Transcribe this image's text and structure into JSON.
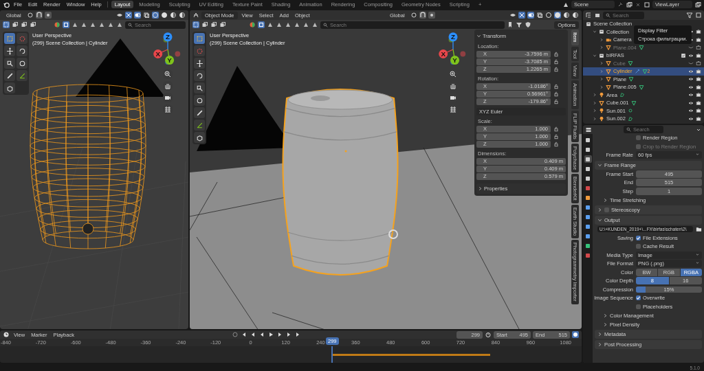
{
  "topbar": {
    "menus": [
      "File",
      "Edit",
      "Render",
      "Window",
      "Help"
    ],
    "workspaces": [
      {
        "label": "Layout",
        "selected": true
      },
      {
        "label": "Modeling",
        "selected": false
      },
      {
        "label": "Sculpting",
        "selected": false
      },
      {
        "label": "UV Editing",
        "selected": false
      },
      {
        "label": "Texture Paint",
        "selected": false
      },
      {
        "label": "Shading",
        "selected": false
      },
      {
        "label": "Animation",
        "selected": false
      },
      {
        "label": "Rendering",
        "selected": false
      },
      {
        "label": "Compositing",
        "selected": false
      },
      {
        "label": "Geometry Nodes",
        "selected": false
      },
      {
        "label": "Scripting",
        "selected": false
      }
    ],
    "add_workspace": "+",
    "scene": "Scene",
    "view_layer": "ViewLayer"
  },
  "viewports": [
    {
      "kind": "wireframe",
      "orientation": "Global",
      "search_placeholder": "Search",
      "view_name": "User Perspective",
      "info": "(299) Scene Collection | Cylinder",
      "tools": [
        {
          "kind": "select",
          "selected": true
        },
        {
          "kind": "cursor",
          "selected": false
        },
        {
          "kind": "move",
          "selected": false
        },
        {
          "kind": "rotate",
          "selected": false
        },
        {
          "kind": "scale",
          "selected": false
        },
        {
          "kind": "transform",
          "selected": false
        },
        {
          "kind": "annotate",
          "selected": false
        },
        {
          "kind": "measure",
          "selected": false
        },
        {
          "kind": "add-cube",
          "selected": false
        }
      ],
      "gizmo_axes": [
        {
          "label": "X",
          "color": "#e8464b"
        },
        {
          "label": "Y",
          "color": "#7fc31c"
        },
        {
          "label": "Z",
          "color": "#2c8fff"
        }
      ]
    },
    {
      "kind": "solid",
      "mode": "Object Mode",
      "menus": [
        "View",
        "Select",
        "Add",
        "Object"
      ],
      "orientation": "Global",
      "search_placeholder": "Search",
      "options": "Options",
      "view_name": "User Perspective",
      "info": "(299) Scene Collection | Cylinder",
      "tools": [
        {
          "kind": "select",
          "selected": true
        },
        {
          "kind": "cursor",
          "selected": false
        },
        {
          "kind": "move",
          "selected": false
        },
        {
          "kind": "rotate",
          "selected": false
        },
        {
          "kind": "scale",
          "selected": false
        },
        {
          "kind": "transform",
          "selected": false
        },
        {
          "kind": "annotate",
          "selected": false
        },
        {
          "kind": "measure",
          "selected": false
        },
        {
          "kind": "add-cube",
          "selected": false
        }
      ],
      "gizmo_axes": [
        {
          "label": "X",
          "color": "#e8464b"
        },
        {
          "label": "Y",
          "color": "#7fc31c"
        },
        {
          "label": "Z",
          "color": "#2c8fff"
        }
      ],
      "sidebar": {
        "tabs": [
          {
            "label": "Item",
            "selected": true
          },
          {
            "label": "Tool",
            "selected": false
          },
          {
            "label": "View",
            "selected": false
          },
          {
            "label": "Animation",
            "selected": false
          },
          {
            "label": "FLIP Fluids",
            "selected": false
          },
          {
            "label": "Polychase",
            "selected": false
          },
          {
            "label": "BlenderKit",
            "selected": false
          },
          {
            "label": "Earth Studio",
            "selected": false
          },
          {
            "label": "Photogrammetry Importer",
            "selected": false
          }
        ],
        "transform": {
          "title": "Transform",
          "expanded": true,
          "groups": [
            {
              "label": "Location:",
              "locks": true,
              "fields": [
                {
                  "axis": "X",
                  "value": "-3.7596 m"
                },
                {
                  "axis": "Y",
                  "value": "-3.7085 m"
                },
                {
                  "axis": "Z",
                  "value": "1.2265 m"
                }
              ]
            },
            {
              "label": "Rotation:",
              "locks": true,
              "fields": [
                {
                  "axis": "X",
                  "value": "-1.0186°"
                },
                {
                  "axis": "Y",
                  "value": "0.56961°"
                },
                {
                  "axis": "Z",
                  "value": "-179.86°"
                }
              ],
              "mode": "XYZ Euler"
            },
            {
              "label": "Scale:",
              "locks": true,
              "fields": [
                {
                  "axis": "X",
                  "value": "1.000"
                },
                {
                  "axis": "Y",
                  "value": "1.000"
                },
                {
                  "axis": "Z",
                  "value": "1.000"
                }
              ]
            },
            {
              "label": "Dimensions:",
              "locks": false,
              "fields": [
                {
                  "axis": "X",
                  "value": "0.409 m"
                },
                {
                  "axis": "Y",
                  "value": "0.409 m"
                },
                {
                  "axis": "Z",
                  "value": "0.579 m"
                }
              ]
            }
          ]
        },
        "properties": {
          "title": "Properties",
          "expanded": false
        }
      }
    }
  ],
  "outliner": {
    "search_placeholder": "Search",
    "tree": [
      {
        "name": "Scene Collection",
        "kind": "scene",
        "selected": false,
        "hidden": false,
        "children": [
          {
            "name": "Collection",
            "kind": "collection",
            "expanded": true,
            "selected": false,
            "hidden": false,
            "children": [
              {
                "name": "Camera",
                "kind": "camera",
                "expanded": false,
                "selected": false,
                "hidden": false
              },
              {
                "name": "Plane.004",
                "kind": "mesh",
                "expanded": false,
                "selected": false,
                "hidden": true
              }
            ]
          },
          {
            "name": "bIRFAS",
            "kind": "collection",
            "expanded": true,
            "selected": false,
            "hidden": false,
            "children": [
              {
                "name": "Cube",
                "kind": "mesh",
                "expanded": false,
                "selected": false,
                "hidden": true
              },
              {
                "name": "Cylinder",
                "kind": "mesh",
                "expanded": false,
                "selected": true,
                "hidden": false,
                "modifiers": true,
                "badge": "2"
              },
              {
                "name": "Plane",
                "kind": "mesh",
                "expanded": false,
                "selected": false,
                "hidden": false
              },
              {
                "name": "Plane.005",
                "kind": "mesh",
                "expanded": false,
                "selected": false,
                "hidden": false
              }
            ]
          },
          {
            "name": "Area",
            "kind": "light",
            "expanded": false,
            "selected": false,
            "hidden": false
          },
          {
            "name": "Cube.001",
            "kind": "mesh",
            "expanded": false,
            "selected": false,
            "hidden": false
          },
          {
            "name": "Sun.001",
            "kind": "sun",
            "expanded": false,
            "selected": false,
            "hidden": false
          },
          {
            "name": "Sun.002",
            "kind": "light",
            "expanded": false,
            "selected": false,
            "hidden": false
          }
        ]
      }
    ]
  },
  "tooltip": {
    "title": "Display Filter",
    "description": "Строка фильтрации."
  },
  "properties": {
    "search_placeholder": "Search",
    "tabs": [
      {
        "color": "#cfcfcf",
        "selected": false
      },
      {
        "color": "#cfcfcf",
        "selected": false
      },
      {
        "color": "#cfcfcf",
        "selected": true
      },
      {
        "color": "#cfcfcf",
        "selected": false
      },
      {
        "color": "#cfcfcf",
        "selected": false
      },
      {
        "color": "#d2484b",
        "selected": false
      },
      {
        "color": "#f09a3c",
        "selected": false
      },
      {
        "color": "#5b9ff0",
        "selected": false
      },
      {
        "color": "#5b9ff0",
        "selected": false
      },
      {
        "color": "#5b9ff0",
        "selected": false
      },
      {
        "color": "#5b9ff0",
        "selected": false
      },
      {
        "color": "#35c27a",
        "selected": false
      },
      {
        "color": "#d2484b",
        "selected": false
      }
    ],
    "rows": [
      {
        "kind": "checkbox",
        "text": "Render Region",
        "checked": false,
        "disabled": false
      },
      {
        "kind": "checkbox",
        "text": "Crop to Render Region",
        "checked": false,
        "disabled": true
      },
      {
        "kind": "dropdown",
        "label": "Frame Rate",
        "value": "60 fps"
      },
      {
        "kind": "section",
        "title": "Frame Range",
        "expanded": true
      },
      {
        "kind": "number",
        "label": "Frame Start",
        "value": "495"
      },
      {
        "kind": "number",
        "label": "End",
        "value": "515"
      },
      {
        "kind": "number",
        "label": "Step",
        "value": "1"
      },
      {
        "kind": "subsection",
        "title": "Time Stretching",
        "expanded": false
      },
      {
        "kind": "section",
        "title": "Stereoscopy",
        "expanded": false,
        "checked": false
      },
      {
        "kind": "section",
        "title": "Output",
        "expanded": true
      },
      {
        "kind": "path",
        "value": "U:\\+KUNDEN_2019+\\...FX\\birfas\\schaten\\2\\"
      },
      {
        "kind": "checkbox",
        "label": "Saving",
        "text": "File Extensions",
        "checked": true,
        "disabled": false
      },
      {
        "kind": "checkbox",
        "text": "Cache Result",
        "checked": false,
        "disabled": false
      },
      {
        "kind": "dropdown",
        "label": "Media Type",
        "value": "Image"
      },
      {
        "kind": "dropdown",
        "label": "File Format",
        "value": "PNG (.png)"
      },
      {
        "kind": "segmented",
        "label": "Color",
        "options": [
          {
            "label": "BW",
            "selected": false
          },
          {
            "label": "RGB",
            "selected": false
          },
          {
            "label": "RGBA",
            "selected": true
          }
        ]
      },
      {
        "kind": "segmented",
        "label": "Color Depth",
        "options": [
          {
            "label": "8",
            "selected": true
          },
          {
            "label": "16",
            "selected": false
          }
        ]
      },
      {
        "kind": "slider",
        "label": "Compression",
        "value": "15%",
        "level": 0.15
      },
      {
        "kind": "checkbox",
        "label": "Image Sequence",
        "text": "Overwrite",
        "checked": true,
        "disabled": false
      },
      {
        "kind": "checkbox",
        "text": "Placeholders",
        "checked": false,
        "disabled": false
      },
      {
        "kind": "subsection",
        "title": "Color Management",
        "expanded": false
      },
      {
        "kind": "subsection",
        "title": "Pixel Density",
        "expanded": false
      },
      {
        "kind": "section",
        "title": "Metadata",
        "expanded": false
      },
      {
        "kind": "section",
        "title": "Post Processing",
        "expanded": false
      }
    ]
  },
  "timeline": {
    "menus": [
      "View",
      "Marker",
      "Playback"
    ],
    "current_frame": "299",
    "start_label": "Start",
    "start": "495",
    "end_label": "End",
    "end": "515",
    "ruler": [
      "-840",
      "-720",
      "-600",
      "-480",
      "-360",
      "-240",
      "-120",
      "0",
      "120",
      "240",
      "360",
      "480",
      "600",
      "720",
      "840",
      "960",
      "1080"
    ],
    "playhead": "299"
  },
  "status_bar": {
    "version": "5.1.0"
  }
}
